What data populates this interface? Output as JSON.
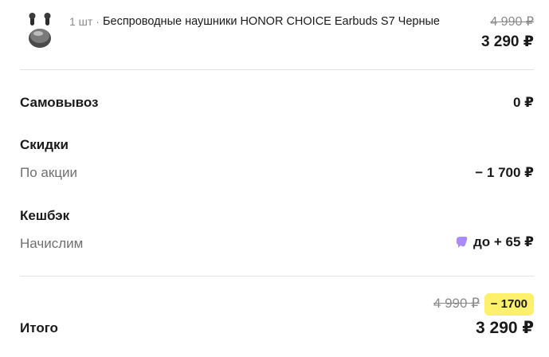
{
  "product": {
    "quantity": "1 шт ·",
    "name": "Беспроводные наушники HONOR CHOICE Earbuds S7 Черные",
    "old_price": "4 990 ₽",
    "price": "3 290 ₽",
    "image_icon": "earbuds-case-image"
  },
  "pickup": {
    "label": "Самовывоз",
    "value": "0 ₽"
  },
  "discounts": {
    "title": "Скидки",
    "promo_label": "По акции",
    "promo_value": "− 1 700 ₽"
  },
  "cashback": {
    "title": "Кешбэк",
    "accrue_label": "Начислим",
    "accrue_value": "до + 65 ₽",
    "icon": "cashback-icon",
    "icon_color": "#a98bff"
  },
  "total": {
    "old_price": "4 990 ₽",
    "discount_badge": "− 1700",
    "badge_color": "#fdf06b",
    "label": "Итого",
    "value": "3 290 ₽"
  }
}
